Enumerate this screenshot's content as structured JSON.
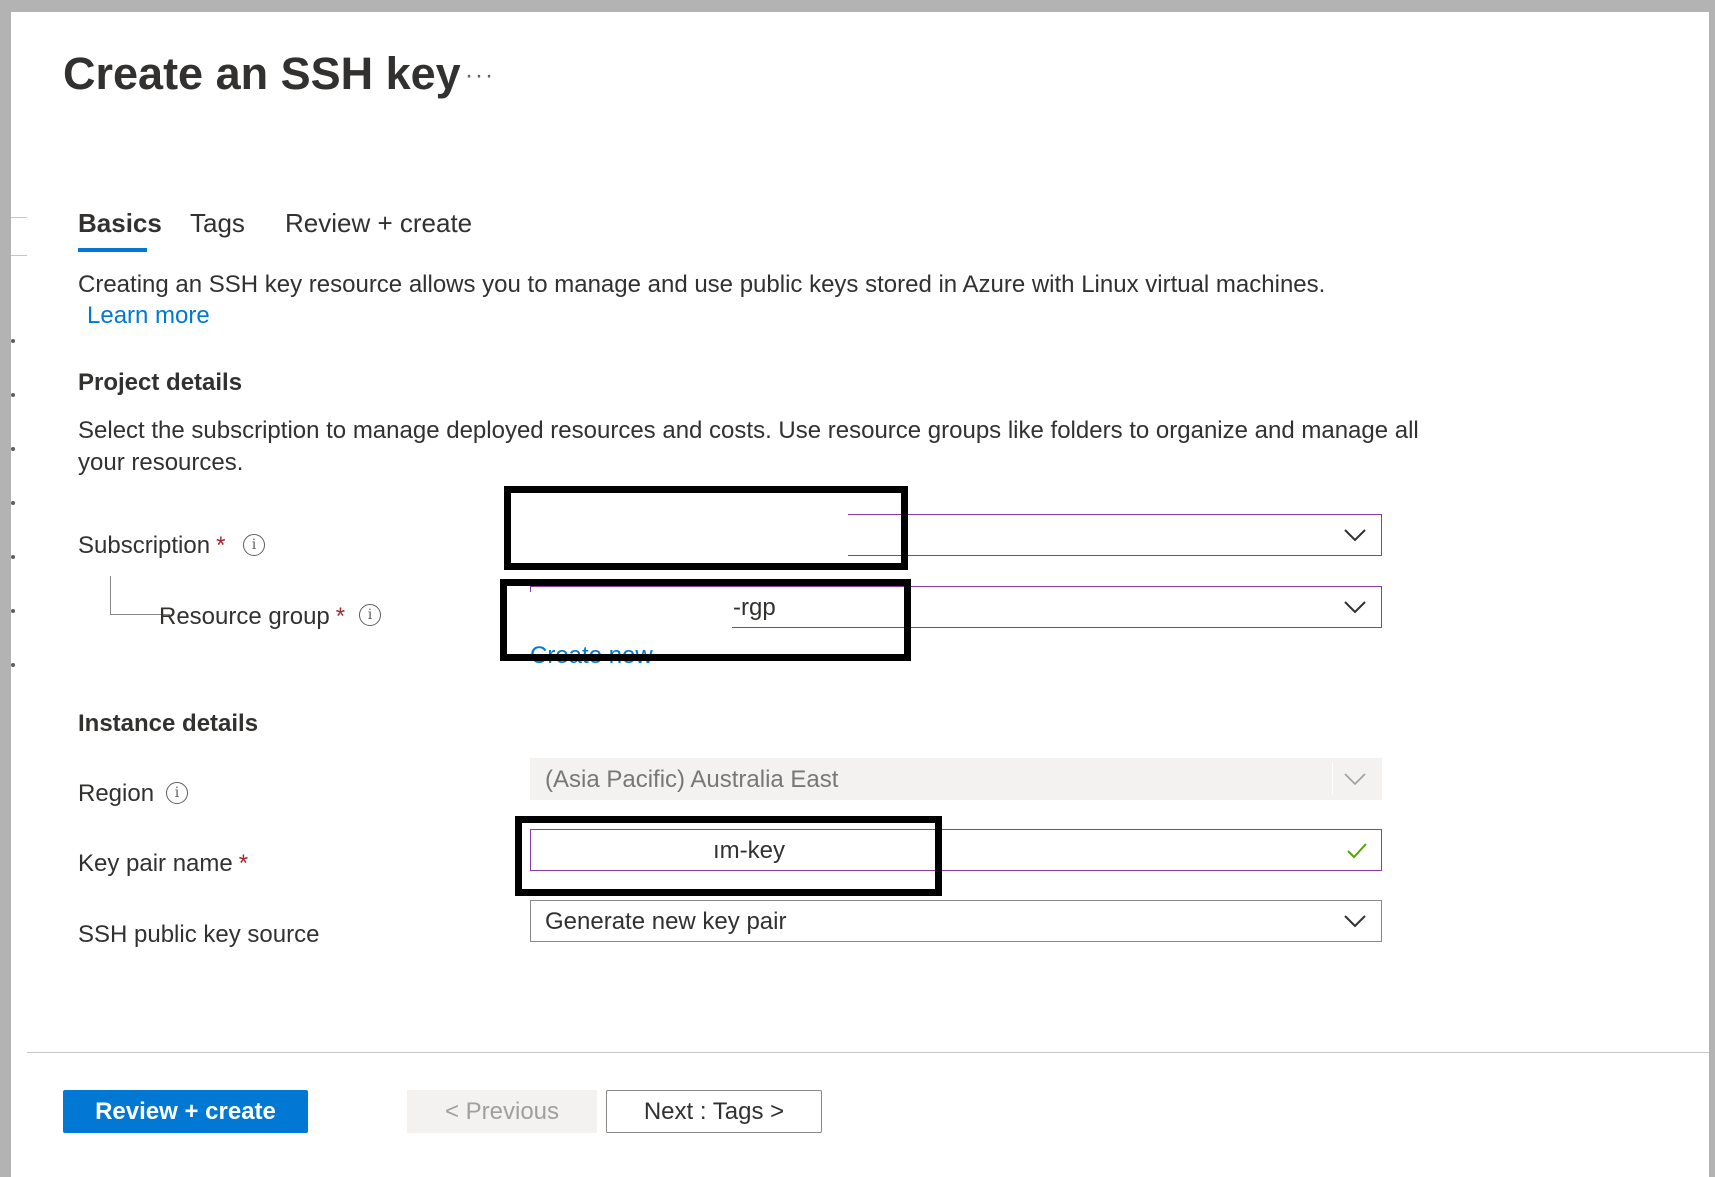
{
  "blade": {
    "title": "Create an SSH key",
    "more_label": "···"
  },
  "tabs": [
    {
      "label": "Basics",
      "active": true
    },
    {
      "label": "Tags",
      "active": false
    },
    {
      "label": "Review + create",
      "active": false
    }
  ],
  "intro": {
    "text": "Creating an SSH key resource allows you to manage and use public keys stored in Azure with Linux virtual machines.",
    "learn_more": "Learn more"
  },
  "project": {
    "heading": "Project details",
    "description_line1": "Select the subscription to manage deployed resources and costs. Use resource groups like folders to organize and manage all",
    "description_line2": "your resources.",
    "subscription": {
      "label": "Subscription",
      "required": "*",
      "value": ""
    },
    "resource_group": {
      "label": "Resource group",
      "required": "*",
      "value": "-rgp",
      "create_new": "Create new"
    }
  },
  "instance": {
    "heading": "Instance details",
    "region": {
      "label": "Region",
      "value": "(Asia Pacific) Australia East"
    },
    "key_pair_name": {
      "label": "Key pair name",
      "required": "*",
      "value": "ım-key"
    },
    "ssh_source": {
      "label": "SSH public key source",
      "value": "Generate new key pair"
    }
  },
  "footer": {
    "review_create": "Review + create",
    "previous": "< Previous",
    "next": "Next : Tags >"
  },
  "colors": {
    "accent": "#0078d4",
    "focus_border": "#8a3aab",
    "required": "#a4262c",
    "valid_check": "#57a300"
  },
  "icons": [
    "ellipsis-icon",
    "info-icon",
    "chevron-down-icon",
    "checkmark-icon"
  ]
}
